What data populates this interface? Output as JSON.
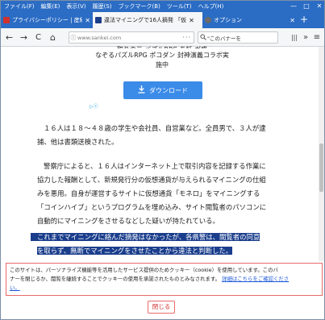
{
  "menubar": {
    "items": [
      "ファイル(F)",
      "編集(E)",
      "表示(V)",
      "履歴(S)",
      "ブックマーク(B)",
      "ツール(T)",
      "ヘルプ(H)"
    ]
  },
  "window_controls": {
    "minimize": "—",
    "maximize": "□",
    "close": "✕"
  },
  "tabs": [
    {
      "label": "プライバシーポリシー | 産経デジ",
      "close": "✕",
      "favicon_color": "#d0312d"
    },
    {
      "label": "違法マイニングで16人摘発 「仮",
      "close": "✕",
      "favicon_color": "#1d3f8a"
    },
    {
      "label": "オプション",
      "close": "✕",
      "favicon_color": "#6b6b6b"
    }
  ],
  "newtab_label": "+",
  "nav": {
    "back": "←",
    "forward": "→",
    "reload": "C",
    "home": "⌂",
    "url": "www.sankei.com",
    "url_icon": "ⓘ",
    "page_actions": "···",
    "search_value": "\"このバナーを",
    "search_icon": "magnifier-icon",
    "library": "|||",
    "overflow": "»",
    "menu": "≡"
  },
  "ad": {
    "clipped_line": "取りの元 バズルRPG あ話 ガ盛",
    "line1": "なぞるパズルRPG ポコダン 封神演義コラボ実",
    "line2": "施中",
    "download_label": "ダウンロード",
    "download_icon": "download-icon",
    "adchoices_label": "▷ⓧ"
  },
  "article": {
    "para1": [
      "１６人は１８～４８歳の学生や会社員、自営業など。全員男で、３人が逮",
      "捕、他は書類送検された。"
    ],
    "para2": [
      "警察庁によると、１６人はインターネット上で取引内容を記録する作業に",
      "協力した報酬として、新規発行分の仮想通貨が与えられるマイニングの仕組",
      "みを悪用。自身が運営するサイトに仮想通貨「モネロ」をマイニングする",
      "「コインハイブ」というプログラムを埋め込み、サイト閲覧者のパソコンに",
      "自動的にマイニングをさせるなどした疑いが持たれている。"
    ],
    "para3": [
      "これまでマイニングに絡んだ摘発はなかったが、各県警は、閲覧者の同意",
      "を取らず、無断でマイニングをさせたことから違法と判断した。"
    ]
  },
  "cookie": {
    "text1": "このサイトは、パーソナライズ機能等を活用したサービス提供のためクッキー（cookie）を使用しています。このバ",
    "text2": "ナーを閉じるか、閲覧を継続することでクッキーの使用を承諾されたものとみなされます。",
    "link": "詳細はこちらをご確認くださ",
    "link_tail": "い。",
    "close_label": "閉じる"
  }
}
